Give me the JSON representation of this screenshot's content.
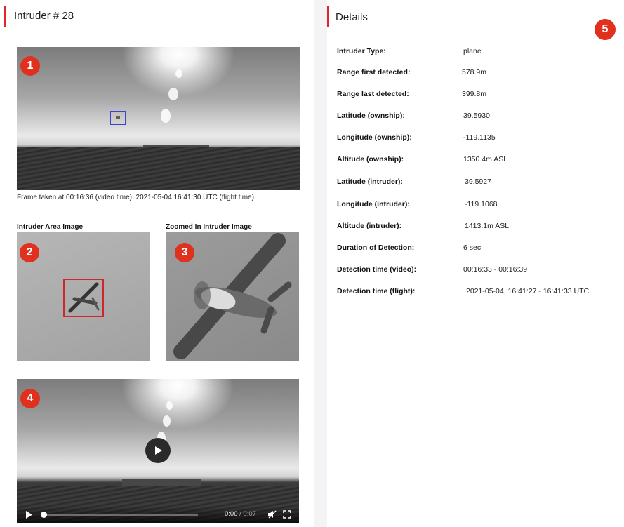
{
  "left": {
    "title": "Intruder # 28",
    "badges": [
      "1",
      "2",
      "3",
      "4"
    ],
    "frame_caption": "Frame taken at 00:16:36 (video time), 2021-05-04 16:41:30 UTC (flight time)",
    "area_label": "Intruder Area Image",
    "zoom_label": "Zoomed In Intruder Image",
    "video": {
      "time_current": "0:00",
      "time_separator": "/",
      "time_total": "0:07",
      "progress_fraction": 0.0
    }
  },
  "right": {
    "title": "Details",
    "badge": "5",
    "rows": [
      {
        "label": "Intruder Type:",
        "value": "plane"
      },
      {
        "label": "Range first detected:",
        "value": "578.9m"
      },
      {
        "label": "Range last detected:",
        "value": "399.8m"
      },
      {
        "label": "Latitude (ownship):",
        "value": "39.5930"
      },
      {
        "label": "Longitude (ownship):",
        "value": "-119.1135"
      },
      {
        "label": "Altitude (ownship):",
        "value": "1350.4m ASL"
      },
      {
        "label": "Latitude (intruder):",
        "value": "39.5927"
      },
      {
        "label": "Longitude (intruder):",
        "value": "-119.1068"
      },
      {
        "label": "Altitude (intruder):",
        "value": "1413.1m ASL"
      },
      {
        "label": "Duration of Detection:",
        "value": "6 sec"
      },
      {
        "label": "Detection time (video):",
        "value": "00:16:33 - 00:16:39"
      },
      {
        "label": "Detection time (flight):",
        "value": "2021-05-04, 16:41:27 - 16:41:33 UTC"
      }
    ]
  },
  "colors": {
    "accent": "#e0252b",
    "badge": "#e0301e",
    "detection_box": "#3a46c8",
    "area_box": "#d0262a"
  },
  "icons": [
    "play-icon",
    "volume-muted-icon",
    "fullscreen-icon",
    "play-large-icon"
  ]
}
